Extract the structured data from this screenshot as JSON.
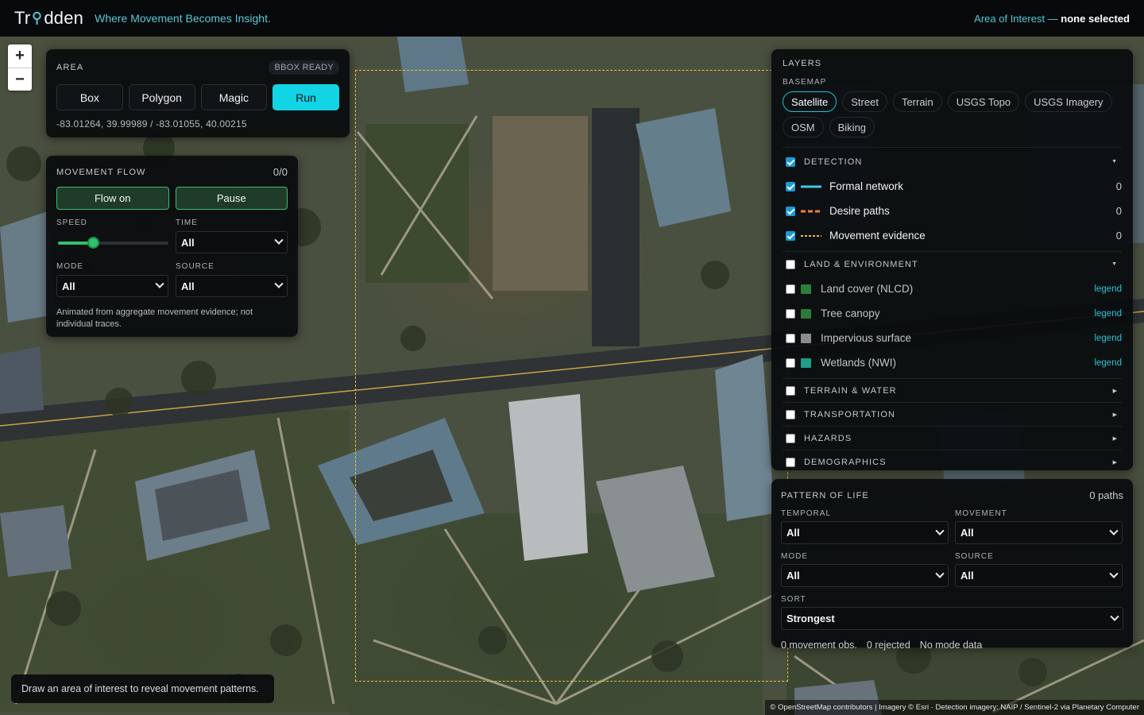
{
  "header": {
    "logo_left": "Tr",
    "logo_right": "dden",
    "tagline": "Where Movement Becomes Insight.",
    "aoi_prefix": "Area of Interest —",
    "aoi_value": "none selected"
  },
  "zoom": {
    "in": "+",
    "out": "−"
  },
  "area": {
    "title": "AREA",
    "badge": "BBOX READY",
    "tools": [
      "Box",
      "Polygon",
      "Magic",
      "Run"
    ],
    "coords": "-83.01264, 39.99989 / -83.01055, 40.00215"
  },
  "flow": {
    "title": "MOVEMENT FLOW",
    "count": "0/0",
    "flow_on": "Flow on",
    "pause": "Pause",
    "speed_label": "SPEED",
    "speed_value": 0.3,
    "time_label": "TIME",
    "time_value": "All",
    "mode_label": "MODE",
    "mode_value": "All",
    "source_label": "SOURCE",
    "source_value": "All",
    "note": "Animated from aggregate movement evidence; not individual traces."
  },
  "layers": {
    "title": "LAYERS",
    "basemap_label": "BASEMAP",
    "basemaps": [
      "Satellite",
      "Street",
      "Terrain",
      "USGS Topo",
      "USGS Imagery",
      "OSM",
      "Biking"
    ],
    "selected_basemap": "Satellite",
    "detection": {
      "label": "DETECTION",
      "items": [
        {
          "label": "Formal network",
          "count": "0",
          "color": "#3fc9e0"
        },
        {
          "label": "Desire paths",
          "count": "0",
          "color": "#ff7a2f"
        },
        {
          "label": "Movement evidence",
          "count": "0",
          "color": "#e9b94a"
        }
      ]
    },
    "land": {
      "label": "LAND & ENVIRONMENT",
      "items": [
        {
          "label": "Land cover (NLCD)",
          "legend": "legend",
          "color": "#2e7d3a"
        },
        {
          "label": "Tree canopy",
          "legend": "legend",
          "color": "#2f7a38"
        },
        {
          "label": "Impervious surface",
          "legend": "legend",
          "color": "#8a8d90"
        },
        {
          "label": "Wetlands (NWI)",
          "legend": "legend",
          "color": "#1f9c8a"
        }
      ]
    },
    "groups": [
      "TERRAIN & WATER",
      "TRANSPORTATION",
      "HAZARDS",
      "DEMOGRAPHICS"
    ]
  },
  "pol": {
    "title": "PATTERN OF LIFE",
    "paths": "0 paths",
    "temporal_label": "TEMPORAL",
    "temporal_value": "All",
    "movement_label": "MOVEMENT",
    "movement_value": "All",
    "mode_label": "MODE",
    "mode_value": "All",
    "source_label": "SOURCE",
    "source_value": "All",
    "sort_label": "SORT",
    "sort_value": "Strongest",
    "stats": [
      "0 movement obs.",
      "0 rejected",
      "No mode data"
    ]
  },
  "toast": "Draw an area of interest to reveal movement patterns.",
  "attribution": "© OpenStreetMap contributors | Imagery © Esri · Detection imagery: NAIP / Sentinel-2 via Planetary Computer",
  "colors": {
    "accent": "#12d4e4",
    "flow_green": "#2ec36a",
    "aoi_dash": "#e7c531"
  }
}
